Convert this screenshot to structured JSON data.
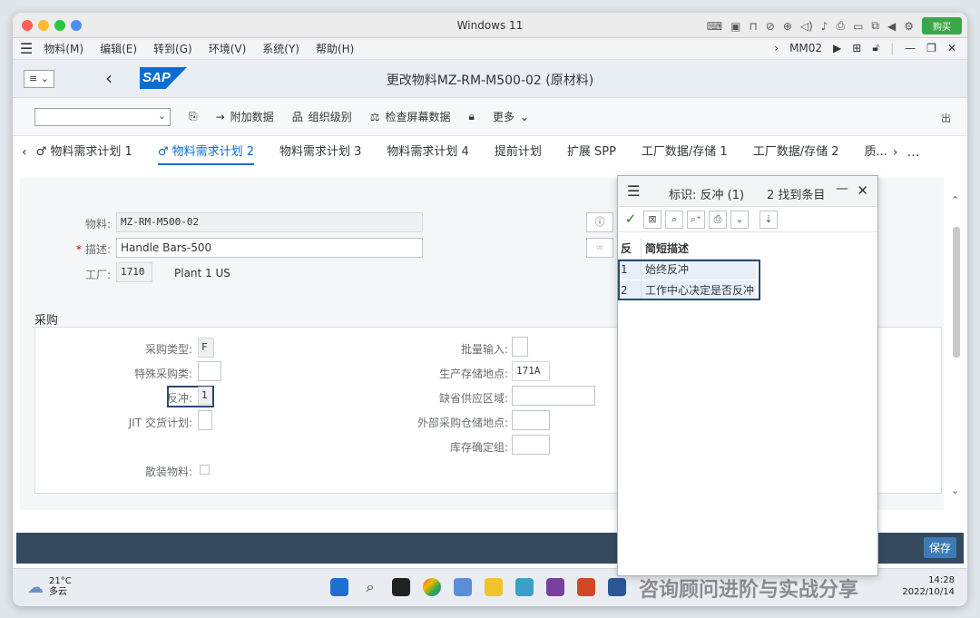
{
  "mac": {
    "title": "Windows 11",
    "buy_label": "购买",
    "colors": {
      "red": "#ff5f57",
      "yellow": "#febc2e",
      "green": "#28c840"
    }
  },
  "menubar": {
    "items": [
      "物料(M)",
      "编辑(E)",
      "转到(G)",
      "环境(V)",
      "系统(Y)",
      "帮助(H)"
    ],
    "tcode": "MM02"
  },
  "shell": {
    "logo": "SAP",
    "title": "更改物料MZ-RM-M500-02 (原材料)"
  },
  "toolbar": {
    "additional_data": "附加数据",
    "org_levels": "组织级别",
    "check_screen_data": "检查屏幕数据",
    "more": "更多",
    "exit": "出"
  },
  "tabs": [
    "物料需求计划 1",
    "物料需求计划 2",
    "物料需求计划 3",
    "物料需求计划 4",
    "提前计划",
    "扩展 SPP",
    "工厂数据/存储 1",
    "工厂数据/存储 2",
    "质..."
  ],
  "header_fields": {
    "material_label": "物料:",
    "material_value": "MZ-RM-M500-02",
    "desc_label": "描述:",
    "desc_value": "Handle Bars-500",
    "plant_label": "工厂:",
    "plant_value": "1710",
    "plant_name": "Plant 1 US"
  },
  "procurement": {
    "section_title": "采购",
    "proc_type_label": "采购类型:",
    "proc_type_value": "F",
    "special_proc_label": "特殊采购类:",
    "special_proc_value": "",
    "backflush_label": "反冲:",
    "backflush_value": "1",
    "jit_label": "JIT 交货计划:",
    "bulk_label": "散装物料:",
    "batch_entry_label": "批量输入:",
    "prod_sloc_label": "生产存储地点:",
    "prod_sloc_value": "171A",
    "default_supply_label": "缺省供应区域:",
    "ext_proc_sloc_label": "外部采购仓储地点:",
    "storage_group_label": "库存确定组:"
  },
  "popup": {
    "title": "标识: 反冲 (1)",
    "found": "2 找到条目",
    "col_key": "反",
    "col_desc": "简短描述",
    "rows": [
      {
        "key": "1",
        "desc": "始终反冲"
      },
      {
        "key": "2",
        "desc": "工作中心决定是否反冲"
      }
    ]
  },
  "footer": {
    "save_label": "保存"
  },
  "taskbar": {
    "temp": "21°C",
    "weather": "多云",
    "watermark": "咨询顾问进阶与实战分享",
    "time": "14:28",
    "date": "2022/10/14"
  }
}
